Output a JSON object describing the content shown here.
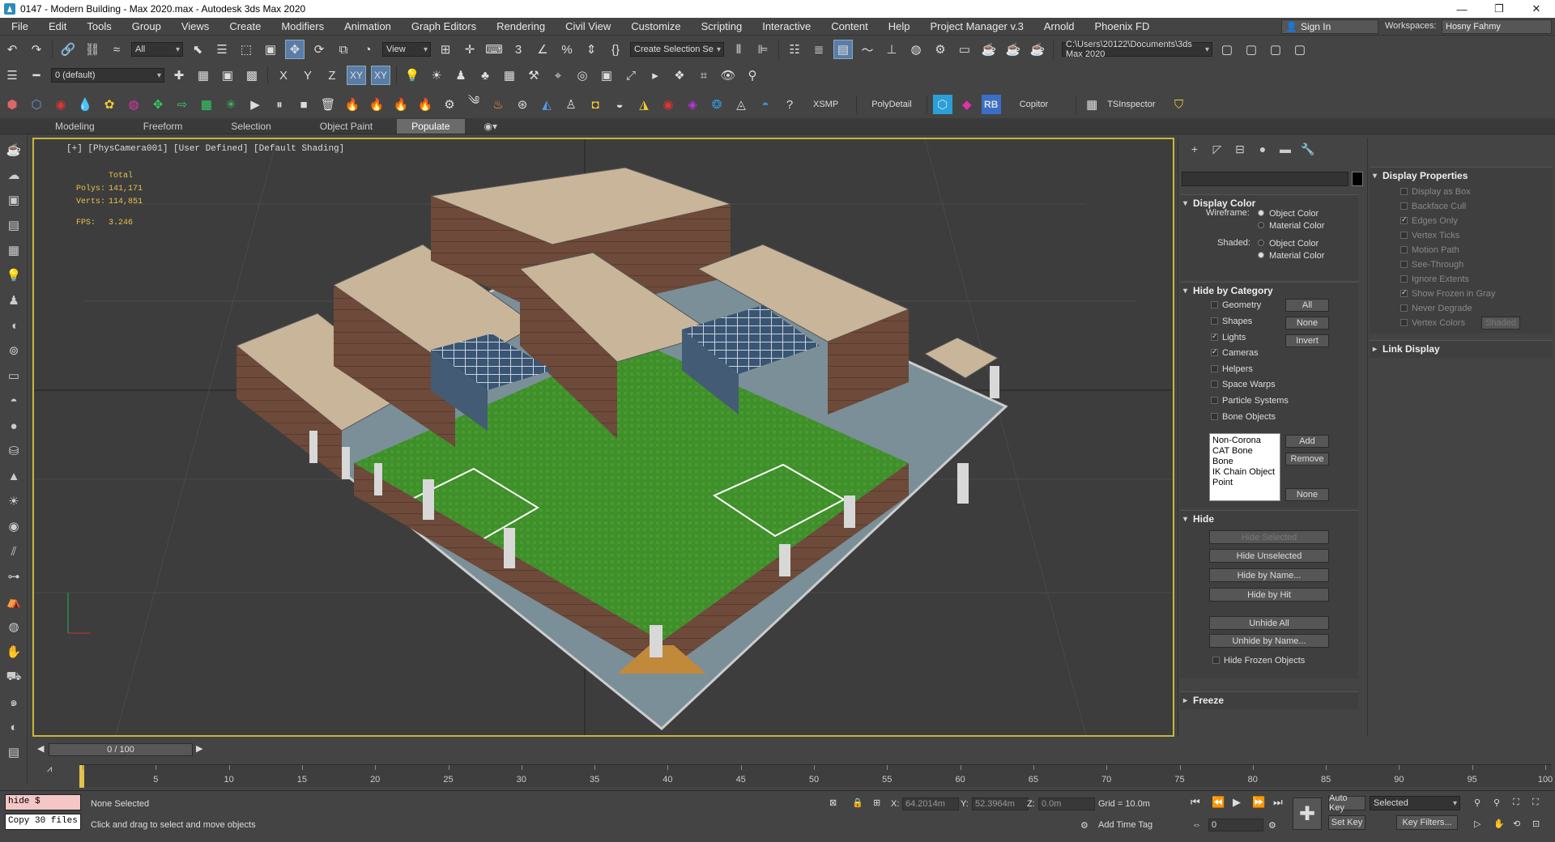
{
  "window": {
    "title": "0147 - Modern Building - Max 2020.max - Autodesk 3ds Max 2020"
  },
  "menu": [
    "File",
    "Edit",
    "Tools",
    "Group",
    "Views",
    "Create",
    "Modifiers",
    "Animation",
    "Graph Editors",
    "Rendering",
    "Civil View",
    "Customize",
    "Scripting",
    "Interactive",
    "Content",
    "Help",
    "Project Manager v.3",
    "Arnold",
    "Phoenix FD"
  ],
  "account": {
    "sign_in": "Sign In",
    "workspaces_label": "Workspaces:",
    "workspace": "Hosny Fahmy"
  },
  "toolbar": {
    "filter": "All",
    "view_dropdown": "View",
    "selection_set": "Create Selection Se",
    "project_path": "C:\\Users\\20122\\Documents\\3ds Max 2020",
    "layer": "0 (default)",
    "axes": [
      "X",
      "Y",
      "Z",
      "XY",
      "XY"
    ],
    "plugins": [
      "XSMP",
      "PolyDetail",
      "RB",
      "Copitor",
      "TSInspector"
    ]
  },
  "ribbon": {
    "tabs": [
      "Modeling",
      "Freeform",
      "Selection",
      "Object Paint",
      "Populate"
    ],
    "active": "Populate"
  },
  "viewport": {
    "label": "[+] [PhysCamera001] [User Defined] [Default Shading]",
    "stats": {
      "header": "Total",
      "polys_label": "Polys:",
      "polys": "141,171",
      "verts_label": "Verts:",
      "verts": "114,851",
      "fps_label": "FPS:",
      "fps": "3.246"
    }
  },
  "command_panel": {
    "display_color": {
      "title": "Display Color",
      "wireframe_label": "Wireframe:",
      "shaded_label": "Shaded:",
      "options": [
        "Object Color",
        "Material Color"
      ],
      "wireframe_selected": "Object Color",
      "shaded_selected": "Material Color"
    },
    "hide_by_category": {
      "title": "Hide by Category",
      "items": [
        {
          "label": "Geometry",
          "checked": false
        },
        {
          "label": "Shapes",
          "checked": false
        },
        {
          "label": "Lights",
          "checked": true
        },
        {
          "label": "Cameras",
          "checked": true
        },
        {
          "label": "Helpers",
          "checked": false
        },
        {
          "label": "Space Warps",
          "checked": false
        },
        {
          "label": "Particle Systems",
          "checked": false
        },
        {
          "label": "Bone Objects",
          "checked": false
        }
      ],
      "buttons": [
        "All",
        "None",
        "Invert"
      ],
      "list": [
        "Non-Corona",
        "CAT Bone",
        "Bone",
        "IK Chain Object",
        "Point"
      ],
      "list_buttons": [
        "Add",
        "Remove",
        "None"
      ]
    },
    "hide": {
      "title": "Hide",
      "buttons": [
        "Hide Selected",
        "Hide Unselected",
        "Hide by Name...",
        "Hide by Hit",
        "Unhide All",
        "Unhide by Name..."
      ],
      "frozen": "Hide Frozen Objects"
    },
    "freeze": {
      "title": "Freeze"
    }
  },
  "display_properties": {
    "title": "Display Properties",
    "items": [
      {
        "label": "Display as Box",
        "checked": false
      },
      {
        "label": "Backface Cull",
        "checked": false
      },
      {
        "label": "Edges Only",
        "checked": true
      },
      {
        "label": "Vertex Ticks",
        "checked": false
      },
      {
        "label": "Motion Path",
        "checked": false
      },
      {
        "label": "See-Through",
        "checked": false
      },
      {
        "label": "Ignore Extents",
        "checked": false
      },
      {
        "label": "Show Frozen in Gray",
        "checked": true
      },
      {
        "label": "Never Degrade",
        "checked": false
      },
      {
        "label": "Vertex Colors",
        "checked": false
      }
    ],
    "shaded_button": "Shaded",
    "link_display": "Link Display"
  },
  "timeline": {
    "frame": "0 / 100",
    "ticks": [
      0,
      5,
      10,
      15,
      20,
      25,
      30,
      35,
      40,
      45,
      50,
      55,
      60,
      65,
      70,
      75,
      80,
      85,
      90,
      95,
      100
    ]
  },
  "status": {
    "script_line1": "hide $",
    "script_line2": "Copy 30 files",
    "selection": "None Selected",
    "prompt": "Click and drag to select and move objects",
    "x_label": "X:",
    "x": "64.2014m",
    "y_label": "Y:",
    "y": "52.3964m",
    "z_label": "Z:",
    "z": "0.0m",
    "grid": "Grid = 10.0m",
    "add_time_tag": "Add Time Tag",
    "auto_key": "Auto Key",
    "set_key": "Set Key",
    "key_mode": "Selected",
    "key_filters": "Key Filters...",
    "current_frame": "0"
  }
}
